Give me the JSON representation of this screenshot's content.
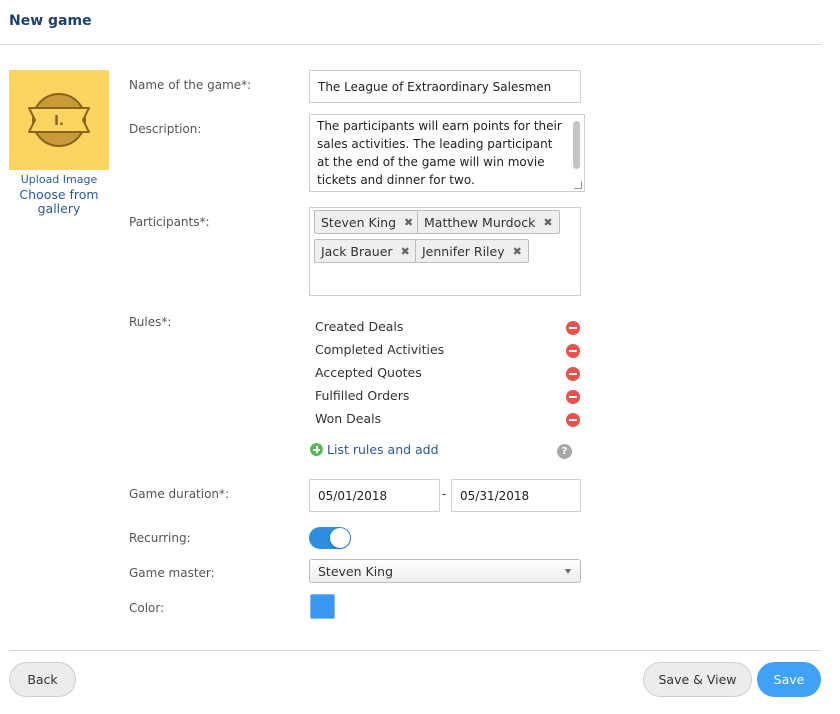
{
  "header": {
    "title": "New game"
  },
  "image_panel": {
    "badge_text": "I.",
    "upload_label": "Upload Image",
    "gallery_label": "Choose from gallery"
  },
  "form": {
    "name": {
      "label": "Name of the game*:",
      "value": "The League of Extraordinary Salesmen"
    },
    "description": {
      "label": "Description:",
      "value": "The participants will earn points for their sales activities. The leading participant at the end of the game will win movie tickets and dinner for two."
    },
    "participants": {
      "label": "Participants*:",
      "items": [
        "Steven King",
        "Matthew Murdock",
        "Jack Brauer",
        "Jennifer Riley"
      ],
      "remove_glyph": "✖"
    },
    "rules": {
      "label": "Rules*:",
      "items": [
        "Created Deals",
        "Completed Activities",
        "Accepted Quotes",
        "Fulfilled Orders",
        "Won Deals"
      ],
      "add_label": "List rules and add",
      "help_glyph": "?"
    },
    "duration": {
      "label": "Game duration*:",
      "start": "05/01/2018",
      "separator": "-",
      "end": "05/31/2018"
    },
    "recurring": {
      "label": "Recurring:",
      "enabled": true
    },
    "game_master": {
      "label": "Game master:",
      "value": "Steven King"
    },
    "color": {
      "label": "Color:",
      "value": "#3c97f0"
    }
  },
  "footer": {
    "back_label": "Back",
    "save_view_label": "Save & View",
    "save_label": "Save"
  }
}
